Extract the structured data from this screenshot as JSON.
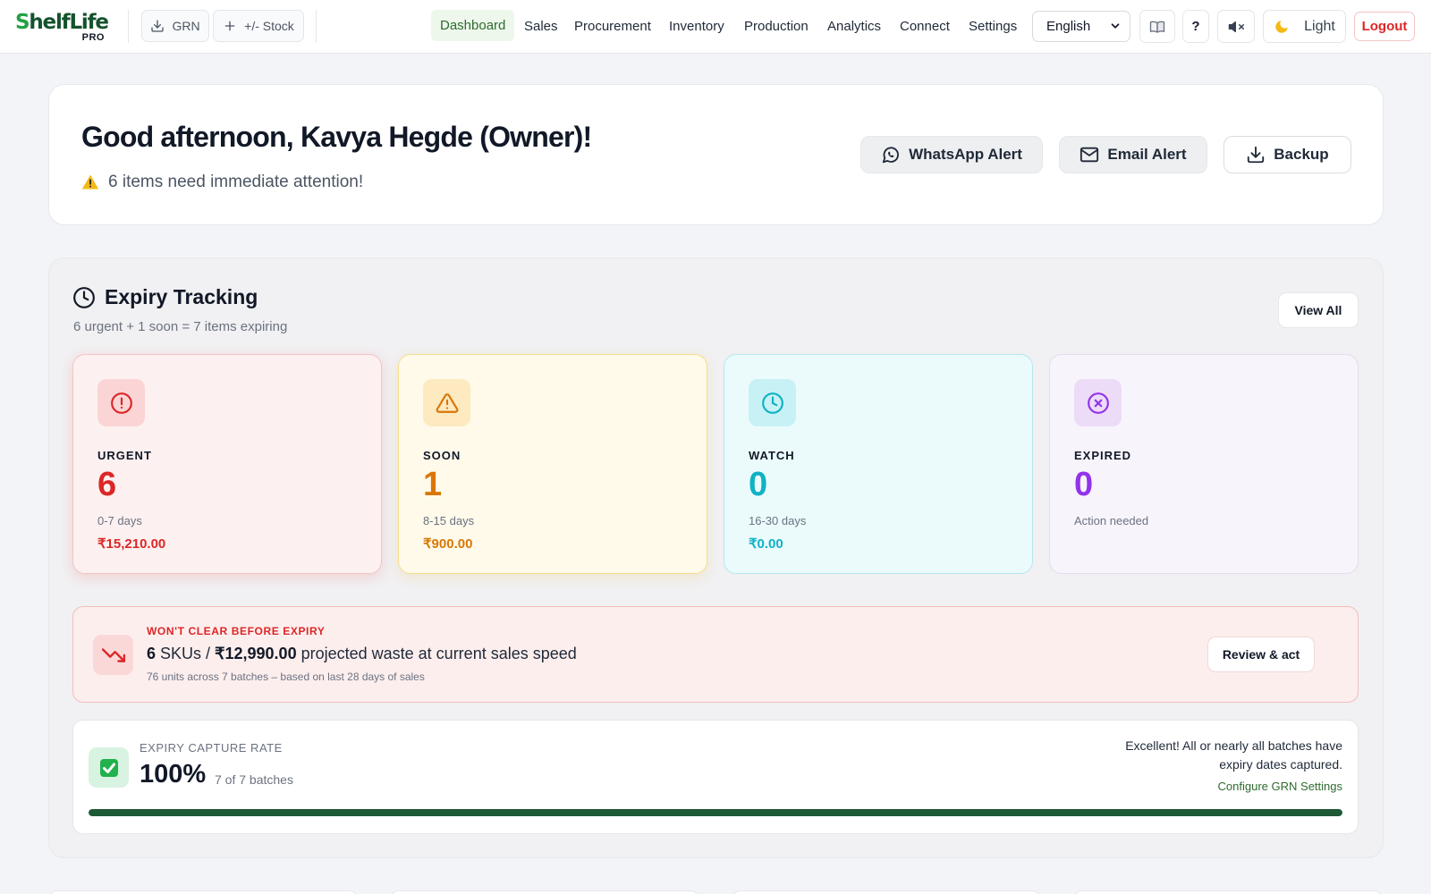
{
  "nav": {
    "logo_text": "helfLife",
    "logo_s": "S",
    "logo_sub": "PRO",
    "grn_label": "GRN",
    "stock_label": "+/- Stock",
    "items": [
      "Dashboard",
      "Sales",
      "Procurement",
      "Inventory",
      "Production",
      "Analytics",
      "Connect",
      "Settings"
    ],
    "active_item": "Dashboard",
    "language": "English",
    "help_label": "?",
    "theme_label": "Light",
    "logout_label": "Logout",
    "icons": [
      "download-icon",
      "plus-icon",
      "book-icon",
      "speaker-muted-icon",
      "moon-icon"
    ]
  },
  "greeting": {
    "title": "Good afternoon, Kavya Hegde (Owner)!",
    "alert": "6 items need immediate attention!",
    "whatsapp_label": "WhatsApp Alert",
    "email_label": "Email Alert",
    "backup_label": "Backup"
  },
  "expiry": {
    "title": "Expiry Tracking",
    "subtitle": "6 urgent + 1 soon = 7 items expiring",
    "view_all": "View All",
    "stats": {
      "urgent": {
        "label": "URGENT",
        "value": "6",
        "range": "0-7 days",
        "amount": "₹15,210.00",
        "color": "#dc2626"
      },
      "soon": {
        "label": "SOON",
        "value": "1",
        "range": "8-15 days",
        "amount": "₹900.00",
        "color": "#d97706"
      },
      "watch": {
        "label": "WATCH",
        "value": "0",
        "range": "16-30 days",
        "amount": "₹0.00",
        "color": "#0fb2c4"
      },
      "expired": {
        "label": "EXPIRED",
        "value": "0",
        "range": "Action needed",
        "color": "#9333ea"
      }
    },
    "waste": {
      "eyebrow": "WON'T CLEAR BEFORE EXPIRY",
      "skus": "6",
      "skus_unit": "SKUs / ",
      "amount": "₹12,990.00",
      "rest": "projected waste at current sales speed",
      "footnote": "76 units across 7 batches – based on last 28 days of sales",
      "action": "Review & act"
    },
    "capture": {
      "eyebrow": "EXPIRY CAPTURE RATE",
      "percent": "100%",
      "fraction": 1.0,
      "of": "7 of 7 batches",
      "note": "Excellent! All or nearly all batches have expiry dates captured.",
      "configure": "Configure GRN Settings"
    }
  }
}
